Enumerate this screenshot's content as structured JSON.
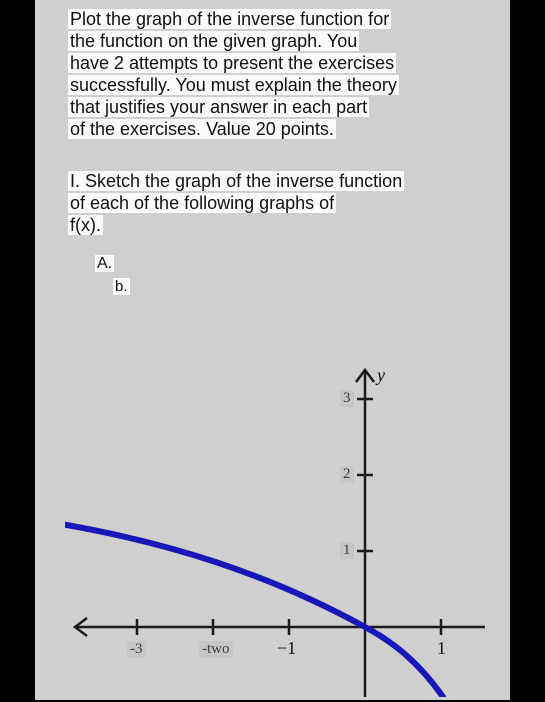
{
  "intro": {
    "l1": "Plot the graph of the inverse function for",
    "l2": "the function on the given graph. You",
    "l3": "have 2 attempts to present the exercises",
    "l4": "successfully. You must explain the theory",
    "l5": "that justifies your answer in each part",
    "l6": "of the exercises. Value 20 points."
  },
  "question": {
    "l1": "I. Sketch the graph of the inverse function",
    "l2": "of each of the following graphs of",
    "l3": "f(x)."
  },
  "options": {
    "a": "A.",
    "b": "b."
  },
  "graph": {
    "y_label": "y",
    "y_ticks": [
      "3",
      "2",
      "1"
    ],
    "x_ticks_left": [
      "-3",
      "-two",
      "−1"
    ],
    "x_ticks_right": [
      "1"
    ]
  },
  "chart_data": {
    "type": "line",
    "title": "",
    "xlabel": "",
    "ylabel": "y",
    "xlim": [
      -4,
      1.3
    ],
    "ylim": [
      -1,
      3.5
    ],
    "series": [
      {
        "name": "f(x)",
        "x": [
          -4.0,
          -3.5,
          -3.0,
          -2.5,
          -2.0,
          -1.5,
          -1.0,
          -0.5,
          0.0,
          0.5,
          1.0
        ],
        "y": [
          1.35,
          1.24,
          1.12,
          1.0,
          0.87,
          0.72,
          0.55,
          0.3,
          0.0,
          -0.45,
          -1.1
        ]
      }
    ]
  }
}
